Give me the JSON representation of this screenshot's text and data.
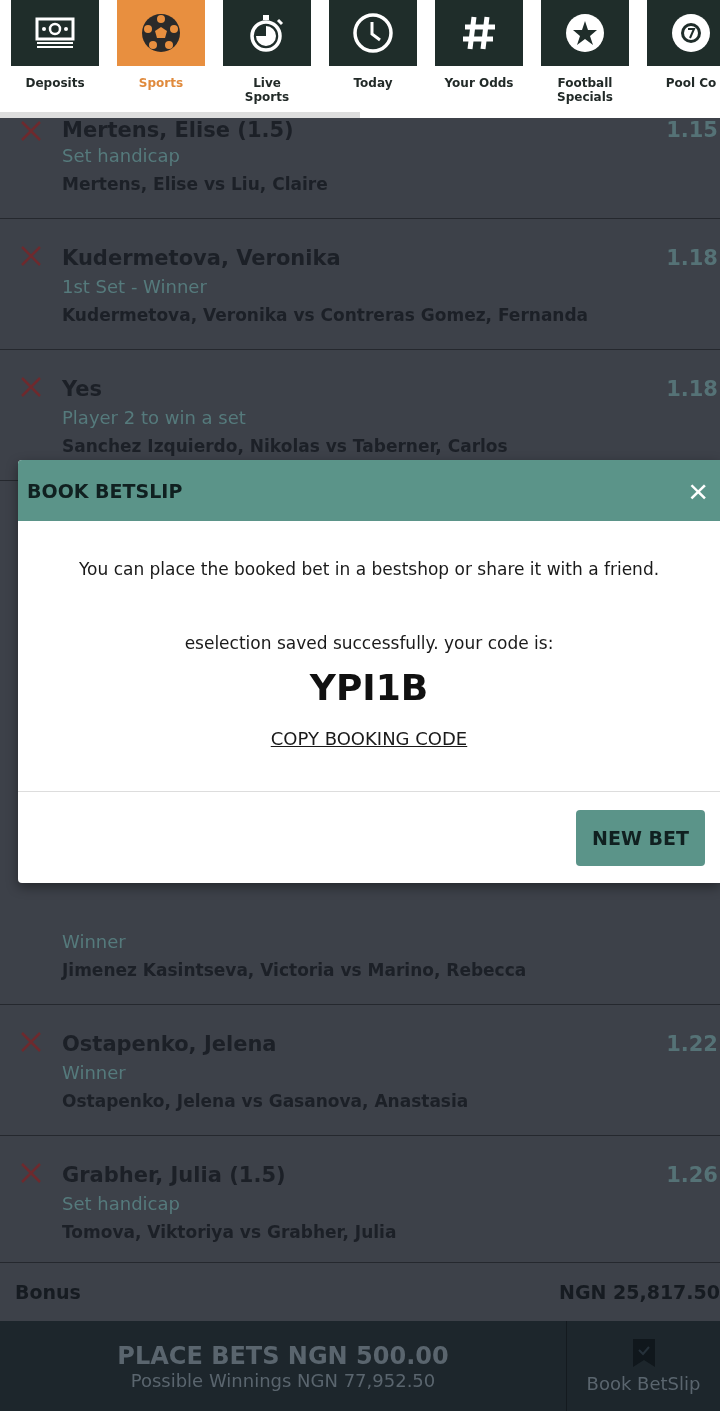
{
  "nav": {
    "items": [
      {
        "label": "Deposits",
        "selected": false
      },
      {
        "label": "Sports",
        "selected": true
      },
      {
        "label": "Live\nSports",
        "selected": false
      },
      {
        "label": "Today",
        "selected": false
      },
      {
        "label": "Your Odds",
        "selected": false
      },
      {
        "label": "Football\nSpecials",
        "selected": false
      },
      {
        "label": "Pool Co",
        "selected": false
      }
    ]
  },
  "bets_top": [
    {
      "title": "Mertens, Elise (1.5)",
      "market": "Set handicap",
      "match": "Mertens, Elise vs Liu, Claire",
      "odds": "1.15"
    },
    {
      "title": "Kudermetova, Veronika",
      "market": "1st Set - Winner",
      "match": "Kudermetova, Veronika vs Contreras Gomez, Fernanda",
      "odds": "1.18"
    },
    {
      "title": "Yes",
      "market": "Player 2 to win a set",
      "match": "Sanchez Izquierdo, Nikolas vs Taberner, Carlos",
      "odds": "1.18"
    }
  ],
  "bets_bottom": [
    {
      "market": "Winner",
      "match": "Jimenez Kasintseva, Victoria vs Marino, Rebecca"
    },
    {
      "title": "Ostapenko, Jelena",
      "market": "Winner",
      "match": "Ostapenko, Jelena vs Gasanova, Anastasia",
      "odds": "1.22"
    },
    {
      "title": "Grabher, Julia (1.5)",
      "market": "Set handicap",
      "match": "Tomova, Viktoriya vs Grabher, Julia",
      "odds": "1.26"
    }
  ],
  "bonus": {
    "label": "Bonus",
    "value": "NGN 25,817.50"
  },
  "footer": {
    "place_bets": "PLACE BETS NGN 500.00",
    "possible_winnings": "Possible Winnings NGN 77,952.50",
    "book_betslip": "Book BetSlip"
  },
  "dialog": {
    "title": "BOOK BETSLIP",
    "close": "×",
    "message": "You can place the booked bet in a bestshop or share it with a friend.",
    "saved": "eselection saved successfully. your code is:",
    "code": "YPI1B",
    "copy_link": "COPY BOOKING CODE",
    "button": "NEW BET"
  }
}
